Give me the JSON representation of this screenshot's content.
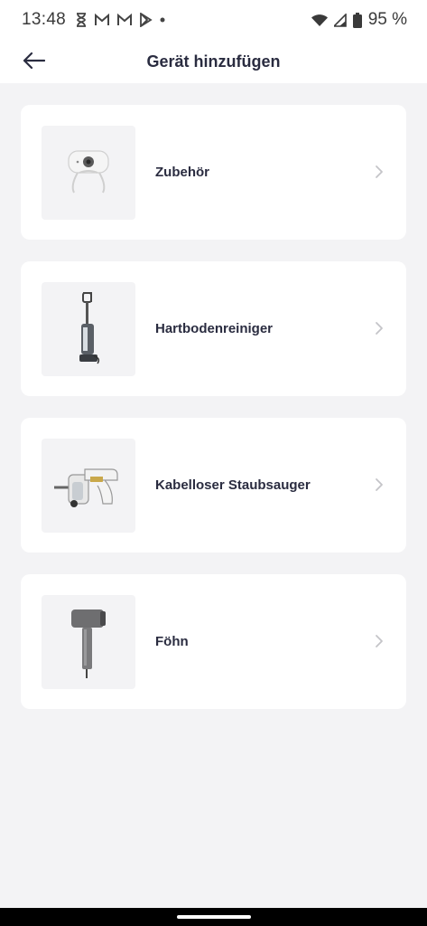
{
  "status": {
    "time": "13:48",
    "notifications": [
      "hourglass-icon",
      "gmail-icon",
      "gmail-icon",
      "play-store-icon",
      "dot-icon"
    ],
    "battery": "95 %"
  },
  "header": {
    "title": "Gerät hinzufügen",
    "back_icon": "back-arrow-icon"
  },
  "devices": [
    {
      "label": "Zubehör",
      "icon": "accessory-icon"
    },
    {
      "label": "Hartbodenreiniger",
      "icon": "floor-cleaner-icon"
    },
    {
      "label": "Kabelloser Staubsauger",
      "icon": "cordless-vacuum-icon"
    },
    {
      "label": "Föhn",
      "icon": "hair-dryer-icon"
    }
  ],
  "colors": {
    "background": "#f3f3f5",
    "card": "#ffffff",
    "text": "#2a2c40",
    "chevron": "#c4c4c8"
  }
}
